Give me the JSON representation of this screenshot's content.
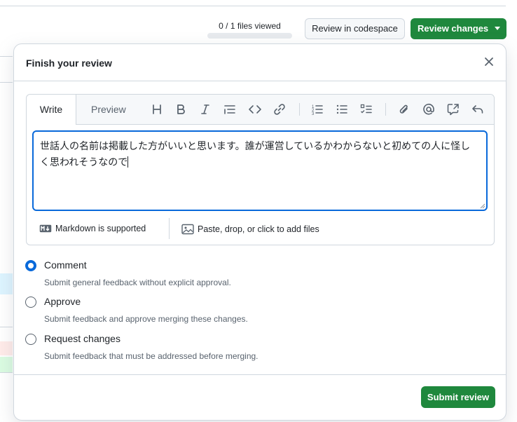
{
  "header": {
    "files_viewed": "0 / 1 files viewed",
    "files_viewed_fraction": 0,
    "codespace_button": "Review in codespace",
    "review_button": "Review changes"
  },
  "dialog": {
    "title": "Finish your review",
    "close_icon": "x-icon",
    "editor": {
      "tab_write": "Write",
      "tab_preview": "Preview",
      "toolbar_icons": [
        "heading-icon",
        "bold-icon",
        "italic-icon",
        "quote-icon",
        "code-icon",
        "link-icon",
        "ordered-list-icon",
        "unordered-list-icon",
        "task-list-icon",
        "paperclip-icon",
        "mention-icon",
        "cross-reference-icon",
        "undo-icon"
      ],
      "text_value": "世話人の名前は掲載した方がいいと思います。誰が運営しているかわからないと初めての人に怪しく思われそうなので",
      "markdown_note": "Markdown is supported",
      "files_note": "Paste, drop, or click to add files"
    },
    "options": [
      {
        "label": "Comment",
        "description": "Submit general feedback without explicit approval.",
        "checked": true
      },
      {
        "label": "Approve",
        "description": "Submit feedback and approve merging these changes.",
        "checked": false
      },
      {
        "label": "Request changes",
        "description": "Submit feedback that must be addressed before merging.",
        "checked": false
      }
    ],
    "submit_button": "Submit review"
  },
  "colors": {
    "accent": "#0969da",
    "primary_button": "#1f883d",
    "border": "#d0d7de",
    "muted_text": "#59636e"
  }
}
